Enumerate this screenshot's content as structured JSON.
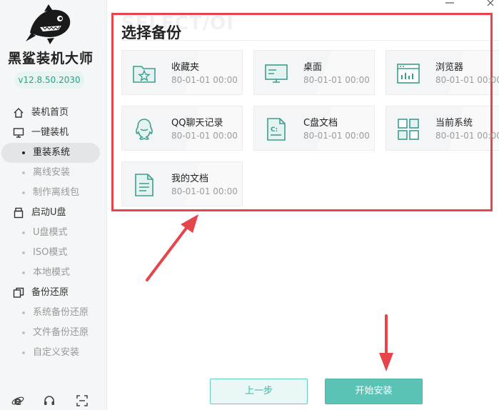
{
  "app": {
    "title": "黑鲨装机大师",
    "version": "v12.8.50.2030"
  },
  "sidebar": {
    "items": [
      {
        "label": "装机首页",
        "icon": "home-icon",
        "type": "main"
      },
      {
        "label": "一键装机",
        "icon": "monitor-icon",
        "type": "main"
      },
      {
        "label": "重装系统",
        "type": "sub",
        "active": true
      },
      {
        "label": "离线安装",
        "type": "sub"
      },
      {
        "label": "制作离线包",
        "type": "sub"
      },
      {
        "label": "启动U盘",
        "icon": "usb-icon",
        "type": "main"
      },
      {
        "label": "U盘模式",
        "type": "sub"
      },
      {
        "label": "ISO模式",
        "type": "sub"
      },
      {
        "label": "本地模式",
        "type": "sub"
      },
      {
        "label": "备份还原",
        "icon": "backup-icon",
        "type": "main"
      },
      {
        "label": "系统备份还原",
        "type": "sub"
      },
      {
        "label": "文件备份还原",
        "type": "sub"
      },
      {
        "label": "自定义安装",
        "type": "sub"
      }
    ],
    "bottom_icons": [
      "ie-browser-icon",
      "headset-icon",
      "scan-icon"
    ]
  },
  "main": {
    "watermark": "SELECT/OI",
    "title": "选择备份",
    "cards": [
      {
        "name": "收藏夹",
        "date": "80-01-01 00:00",
        "icon": "favorites-folder-icon"
      },
      {
        "name": "桌面",
        "date": "80-01-01 00:00",
        "icon": "desktop-icon"
      },
      {
        "name": "浏览器",
        "date": "80-01-01 00:00",
        "icon": "browser-icon"
      },
      {
        "name": "QQ聊天记录",
        "date": "80-01-01 00:00",
        "icon": "qq-icon"
      },
      {
        "name": "C盘文档",
        "date": "80-01-01 00:00",
        "icon": "c-drive-doc-icon"
      },
      {
        "name": "当前系统",
        "date": "80-01-01 00:00",
        "icon": "system-grid-icon"
      },
      {
        "name": "我的文档",
        "date": "80-01-01 00:00",
        "icon": "document-icon"
      }
    ]
  },
  "buttons": {
    "prev": "上一步",
    "start": "开始安装"
  },
  "colors": {
    "accent": "#5bc3b5",
    "highlight": "#e5454b",
    "icon": "#3e9d90"
  }
}
